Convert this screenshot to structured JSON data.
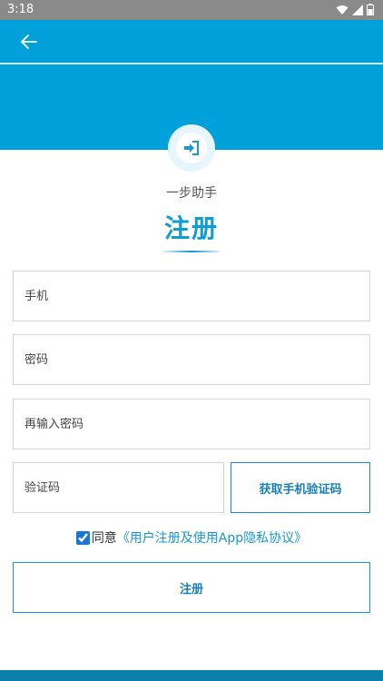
{
  "status_bar": {
    "time": "3:18"
  },
  "header": {
    "subtitle": "一步助手",
    "title": "注册"
  },
  "form": {
    "phone_placeholder": "手机",
    "password_placeholder": "密码",
    "confirm_password_placeholder": "再输入密码",
    "code_placeholder": "验证码",
    "get_code_label": "获取手机验证码",
    "agree_prefix": "同意",
    "agree_link": "《用户注册及使用App隐私协议》",
    "agree_checked": true,
    "submit_label": "注册"
  },
  "colors": {
    "primary": "#00a1db",
    "accent": "#1a98d5"
  },
  "icons": {
    "back": "arrow-left-icon",
    "badge": "sign-in-icon",
    "wifi": "wifi-icon",
    "signal": "signal-icon",
    "battery": "battery-icon"
  }
}
